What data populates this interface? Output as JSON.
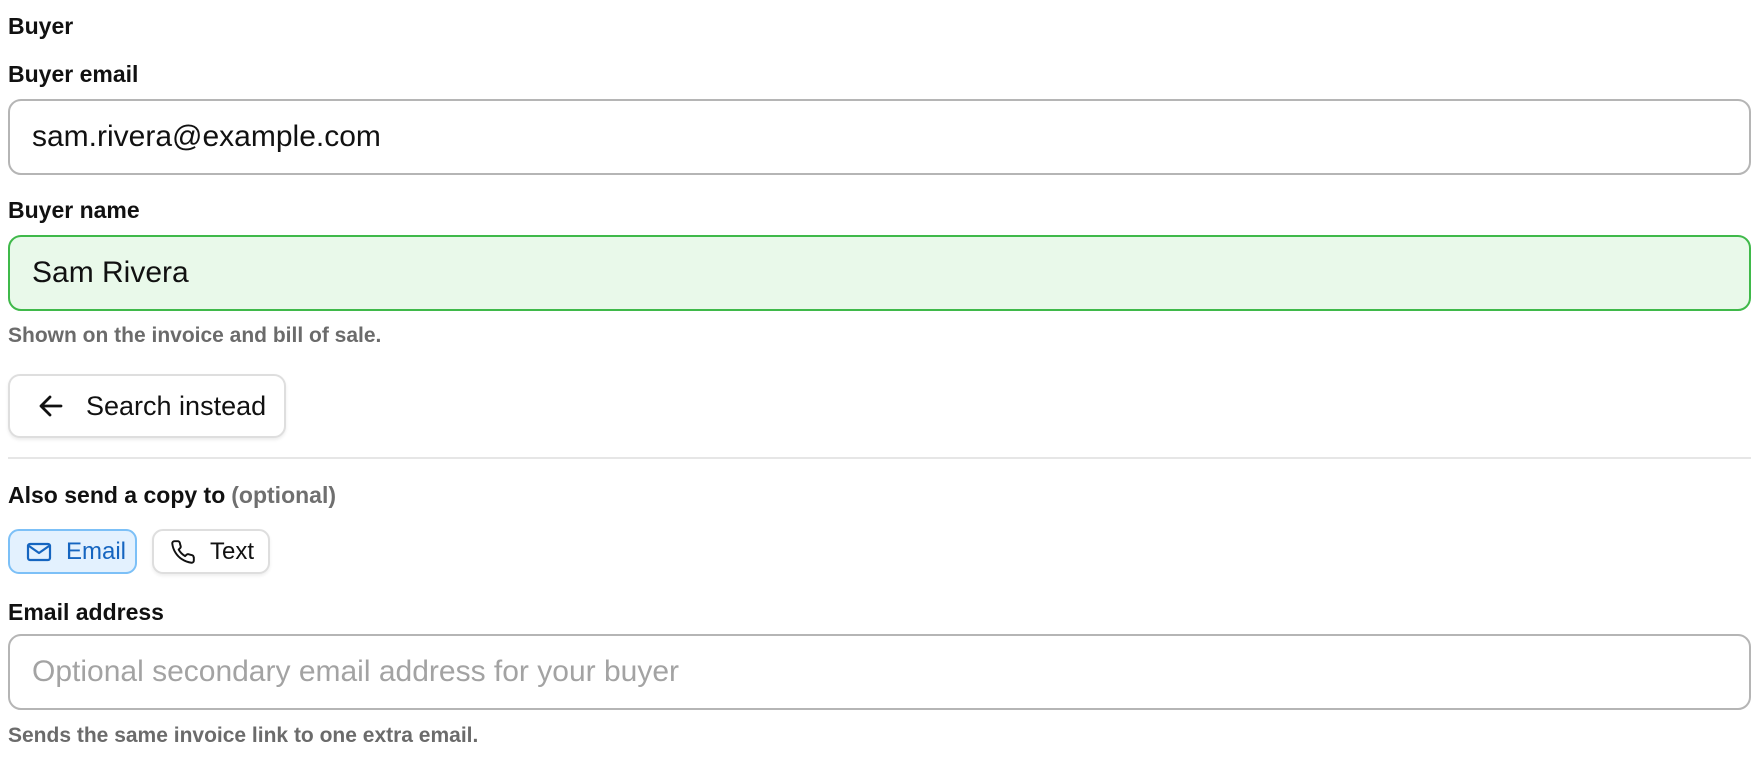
{
  "section": {
    "title": "Buyer"
  },
  "buyer_email": {
    "label": "Buyer email",
    "value": "sam.rivera@example.com"
  },
  "buyer_name": {
    "label": "Buyer name",
    "value": "Sam Rivera",
    "hint": "Shown on the invoice and bill of sale."
  },
  "search_button": {
    "label": "Search instead",
    "icon": "arrow-left-icon"
  },
  "copy": {
    "label": "Also send a copy to",
    "optional": "(optional)",
    "options": [
      {
        "label": "Email",
        "icon": "mail-icon",
        "selected": true
      },
      {
        "label": "Text",
        "icon": "phone-icon",
        "selected": false
      }
    ]
  },
  "secondary_email": {
    "label": "Email address",
    "value": "",
    "placeholder": "Optional secondary email address for your buyer",
    "hint": "Sends the same invoice link to one extra email."
  },
  "colors": {
    "valid_background": "#e9f9ea",
    "valid_border": "#3fb94a",
    "selected_chip_background": "#e3f1fe",
    "selected_chip_border": "#7cc0f7",
    "selected_chip_text": "#1565c0",
    "hint_text": "#6b6b6b"
  }
}
